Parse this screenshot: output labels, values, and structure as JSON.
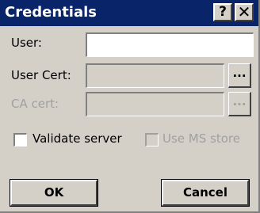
{
  "window": {
    "title": "Credentials",
    "help_label": "?",
    "close_label": "✕"
  },
  "form": {
    "user_label": "User:",
    "user_value": "",
    "user_cert_label": "User Cert:",
    "user_cert_value": "",
    "ca_cert_label": "CA cert:",
    "ca_cert_value": "",
    "browse_label": "...",
    "validate_server_label": "Validate server",
    "validate_server_checked": false,
    "use_ms_store_label": "Use MS store",
    "use_ms_store_checked": false,
    "use_ms_store_enabled": false,
    "ca_cert_enabled": false
  },
  "buttons": {
    "ok_label": "OK",
    "cancel_label": "Cancel"
  },
  "colors": {
    "titlebar": "#0a246a",
    "dialog_bg": "#d4d0c8",
    "disabled_text": "#a0a0a0"
  }
}
